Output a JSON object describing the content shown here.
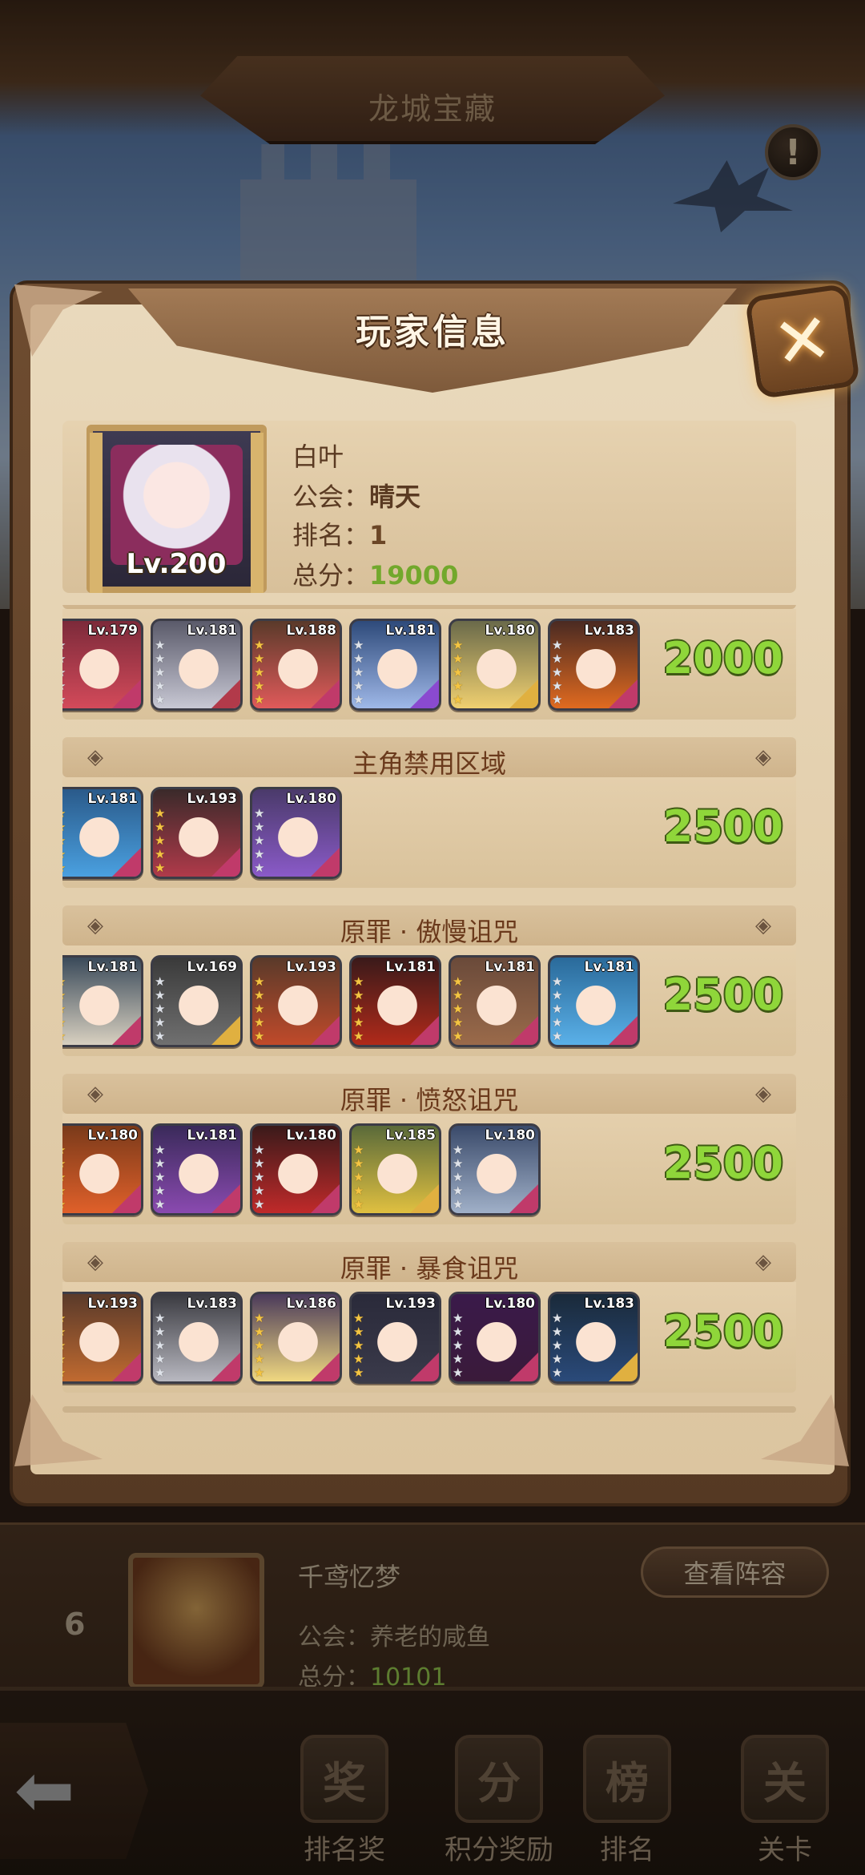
{
  "screen": {
    "title": "龙城宝藏"
  },
  "modal": {
    "title": "玩家信息",
    "close_icon": "close-x-icon",
    "player": {
      "name": "白叶",
      "level": "Lv.200",
      "guild_label": "公会：",
      "guild": "晴天",
      "rank_label": "排名：",
      "rank": "1",
      "score_label": "总分：",
      "score": "19000"
    },
    "teams": [
      {
        "title": "",
        "score": "2000",
        "heroes": [
          {
            "level": "Lv.179",
            "stars": 5,
            "star_color": "silver",
            "bg": "#7c2a3a",
            "hair": "#d34a5a",
            "tag": "#c03a6a"
          },
          {
            "level": "Lv.181",
            "stars": 5,
            "star_color": "silver",
            "bg": "#5a5a6a",
            "hair": "#c8c8d4",
            "tag": "#b23a4a"
          },
          {
            "level": "Lv.188",
            "stars": 5,
            "star_color": "gold",
            "bg": "#5a3a2a",
            "hair": "#e05a5a",
            "tag": "#c03a6a"
          },
          {
            "level": "Lv.181",
            "stars": 5,
            "star_color": "silver",
            "bg": "#2e4a7a",
            "hair": "#9fb8e8",
            "tag": "#8a4ad0"
          },
          {
            "level": "Lv.180",
            "stars": 5,
            "star_color": "gold",
            "bg": "#6a6a4a",
            "hair": "#f0d070",
            "tag": "#e0b040"
          },
          {
            "level": "Lv.183",
            "stars": 5,
            "star_color": "silver",
            "bg": "#4a2a22",
            "hair": "#e06a20",
            "tag": "#c03a6a"
          }
        ]
      },
      {
        "title": "主角禁用区域",
        "score": "2500",
        "heroes": [
          {
            "level": "Lv.181",
            "stars": 5,
            "star_color": "gold",
            "bg": "#2a5a8a",
            "hair": "#4aa0e0",
            "tag": "#c03a6a"
          },
          {
            "level": "Lv.193",
            "stars": 5,
            "star_color": "gold",
            "bg": "#3a2a2a",
            "hair": "#b03a4a",
            "tag": "#c03a6a"
          },
          {
            "level": "Lv.180",
            "stars": 5,
            "star_color": "silver",
            "bg": "#4a3a6a",
            "hair": "#8a5ac8",
            "tag": "#c03a6a"
          }
        ]
      },
      {
        "title": "原罪 · 傲慢诅咒",
        "score": "2500",
        "heroes": [
          {
            "level": "Lv.181",
            "stars": 5,
            "star_color": "gold",
            "bg": "#3a4a5a",
            "hair": "#d8d0c0",
            "tag": "#c03a6a"
          },
          {
            "level": "Lv.169",
            "stars": 5,
            "star_color": "silver",
            "bg": "#3a3a3a",
            "hair": "#707070",
            "tag": "#e0b040"
          },
          {
            "level": "Lv.193",
            "stars": 5,
            "star_color": "gold",
            "bg": "#5a3a2a",
            "hair": "#c04a2a",
            "tag": "#c03a6a"
          },
          {
            "level": "Lv.181",
            "stars": 5,
            "star_color": "gold",
            "bg": "#3a1a1a",
            "hair": "#b02a1a",
            "tag": "#c03a6a"
          },
          {
            "level": "Lv.181",
            "stars": 5,
            "star_color": "gold",
            "bg": "#6a4a3a",
            "hair": "#9a6a4a",
            "tag": "#c03a6a"
          },
          {
            "level": "Lv.181",
            "stars": 5,
            "star_color": "silver",
            "bg": "#2a6a9a",
            "hair": "#5ab0e8",
            "tag": "#c03a6a"
          }
        ]
      },
      {
        "title": "原罪 · 愤怒诅咒",
        "score": "2500",
        "heroes": [
          {
            "level": "Lv.180",
            "stars": 5,
            "star_color": "gold",
            "bg": "#7a3a1a",
            "hair": "#e0602a",
            "tag": "#c03a6a"
          },
          {
            "level": "Lv.181",
            "stars": 5,
            "star_color": "silver",
            "bg": "#3a2a5a",
            "hair": "#8a4ab0",
            "tag": "#c03a6a"
          },
          {
            "level": "Lv.180",
            "stars": 5,
            "star_color": "silver",
            "bg": "#3a1a1a",
            "hair": "#c02a2a",
            "tag": "#c03a6a"
          },
          {
            "level": "Lv.185",
            "stars": 5,
            "star_color": "gold",
            "bg": "#5a6a3a",
            "hair": "#e0c040",
            "tag": "#e0b040"
          },
          {
            "level": "Lv.180",
            "stars": 5,
            "star_color": "silver",
            "bg": "#3a4a6a",
            "hair": "#a0b0c8",
            "tag": "#c03a6a"
          }
        ]
      },
      {
        "title": "原罪 · 暴食诅咒",
        "score": "2500",
        "heroes": [
          {
            "level": "Lv.193",
            "stars": 5,
            "star_color": "gold",
            "bg": "#5a3a2a",
            "hair": "#c06a30",
            "tag": "#c03a6a"
          },
          {
            "level": "Lv.183",
            "stars": 5,
            "star_color": "silver",
            "bg": "#3a3a40",
            "hair": "#b8b8c0",
            "tag": "#c03a6a"
          },
          {
            "level": "Lv.186",
            "stars": 5,
            "star_color": "gold",
            "bg": "#4a3a5a",
            "hair": "#f0d880",
            "tag": "#c03a6a"
          },
          {
            "level": "Lv.193",
            "stars": 5,
            "star_color": "gold",
            "bg": "#2a2a3a",
            "hair": "#3a3a4a",
            "tag": "#c03a6a"
          },
          {
            "level": "Lv.180",
            "stars": 5,
            "star_color": "silver",
            "bg": "#3a1a4a",
            "hair": "#3a1a3a",
            "tag": "#c03a6a"
          },
          {
            "level": "Lv.183",
            "stars": 5,
            "star_color": "silver",
            "bg": "#1a2a3a",
            "hair": "#2a4a7a",
            "tag": "#e0b040"
          }
        ]
      }
    ]
  },
  "behind_list": {
    "rank": "6",
    "name": "千鸢忆梦",
    "guild_label": "公会：",
    "guild": "养老的咸鱼",
    "score_label": "总分：",
    "score": "10101",
    "view_button": "查看阵容"
  },
  "bottom_nav": [
    {
      "label": "排名奖",
      "icon": "trophy-icon"
    },
    {
      "label": "积分奖励",
      "icon": "reward-icon"
    },
    {
      "label": "排名",
      "icon": "ranking-icon"
    },
    {
      "label": "关卡",
      "icon": "stage-icon"
    }
  ],
  "colors": {
    "score_green": "#8fd63a",
    "parchment": "#e4cfac",
    "title_brown": "#6b3a1c"
  }
}
